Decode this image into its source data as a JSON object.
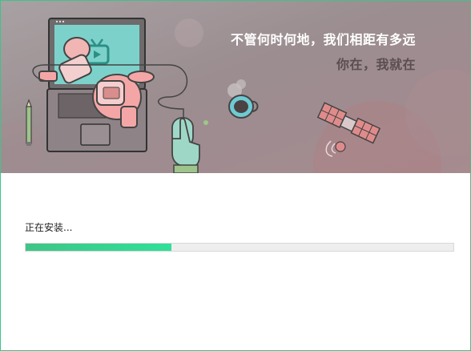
{
  "banner": {
    "slogan_line1": "不管何时何地，我们相距有多远",
    "slogan_line2": "你在，我就在"
  },
  "install": {
    "status_text": "正在安装...",
    "progress_fraction": 0.34
  },
  "colors": {
    "border": "#3cc48a",
    "progress_fill": "#3ec587",
    "progress_track": "#eeeeee"
  },
  "icons": [
    "laptop-icon",
    "tv-icon",
    "astronaut-icon",
    "mouse-icon",
    "hand-icon",
    "coffee-cup-icon",
    "satellite-icon",
    "pencil-icon"
  ]
}
